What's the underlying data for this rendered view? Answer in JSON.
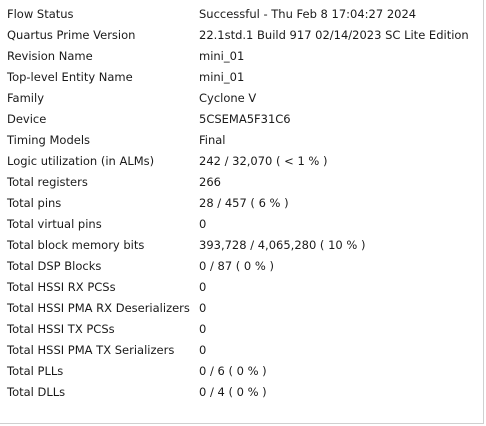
{
  "summary": {
    "rows": [
      {
        "label": "Flow Status",
        "value": "Successful - Thu Feb  8 17:04:27 2024"
      },
      {
        "label": "Quartus Prime Version",
        "value": "22.1std.1 Build 917 02/14/2023 SC Lite Edition"
      },
      {
        "label": "Revision Name",
        "value": "mini_01"
      },
      {
        "label": "Top-level Entity Name",
        "value": "mini_01"
      },
      {
        "label": "Family",
        "value": "Cyclone V"
      },
      {
        "label": "Device",
        "value": "5CSEMA5F31C6"
      },
      {
        "label": "Timing Models",
        "value": "Final"
      },
      {
        "label": "Logic utilization (in ALMs)",
        "value": "242 / 32,070 ( < 1 % )"
      },
      {
        "label": "Total registers",
        "value": "266"
      },
      {
        "label": "Total pins",
        "value": "28 / 457 ( 6 % )"
      },
      {
        "label": "Total virtual pins",
        "value": "0"
      },
      {
        "label": "Total block memory bits",
        "value": "393,728 / 4,065,280 ( 10 % )"
      },
      {
        "label": "Total DSP Blocks",
        "value": "0 / 87 ( 0 % )"
      },
      {
        "label": "Total HSSI RX PCSs",
        "value": "0"
      },
      {
        "label": "Total HSSI PMA RX Deserializers",
        "value": "0"
      },
      {
        "label": "Total HSSI TX PCSs",
        "value": "0"
      },
      {
        "label": "Total HSSI PMA TX Serializers",
        "value": "0"
      },
      {
        "label": "Total PLLs",
        "value": "0 / 6 ( 0 % )"
      },
      {
        "label": "Total DLLs",
        "value": "0 / 4 ( 0 % )"
      }
    ]
  }
}
